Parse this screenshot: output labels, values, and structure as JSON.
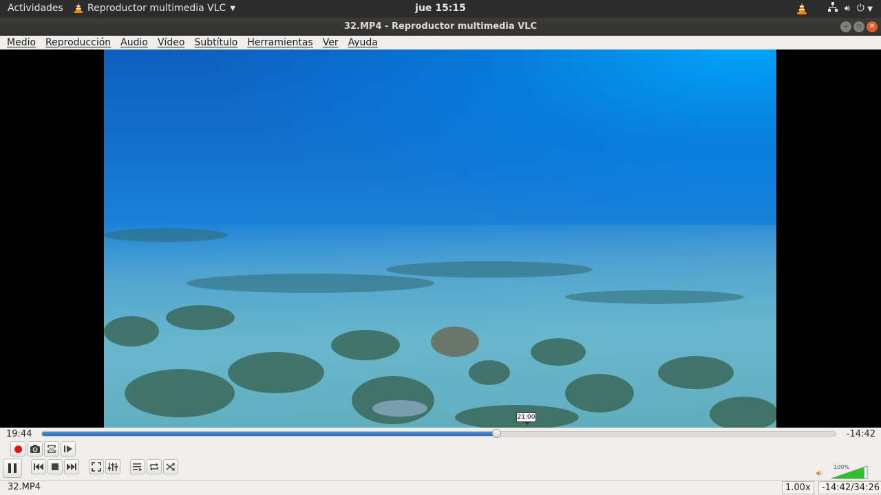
{
  "topbar": {
    "activities": "Actividades",
    "app_menu": "Reproductor multimedia VLC",
    "clock": "jue 15:15"
  },
  "window": {
    "title": "32.MP4 - Reproductor multimedia VLC"
  },
  "menu": [
    "Medio",
    "Reproducción",
    "Audio",
    "Vídeo",
    "Subtítulo",
    "Herramientas",
    "Ver",
    "Ayuda"
  ],
  "player": {
    "elapsed": "19:44",
    "remaining": "-14:42",
    "tooltip": "21:00",
    "progress_fraction": 0.572,
    "volume_label": "100%",
    "volume_fraction": 1.0
  },
  "status": {
    "filename": "32.MP4",
    "speed": "1.00x",
    "time": "-14:42/34:26"
  },
  "colors": {
    "accent": "#2a6fc0",
    "record": "#e3101a",
    "volume": "#2fbf2f",
    "vlc_orange": "#f08a00"
  },
  "icons": {
    "topbar": [
      "vlc-cone-icon",
      "network-icon",
      "volume-icon",
      "power-icon"
    ],
    "controls": [
      "record-icon",
      "snapshot-icon",
      "ab-loop-icon",
      "frame-step-icon",
      "pause-icon",
      "previous-icon",
      "stop-icon",
      "next-icon",
      "fullscreen-icon",
      "extended-settings-icon",
      "playlist-icon",
      "loop-icon",
      "shuffle-icon"
    ]
  }
}
